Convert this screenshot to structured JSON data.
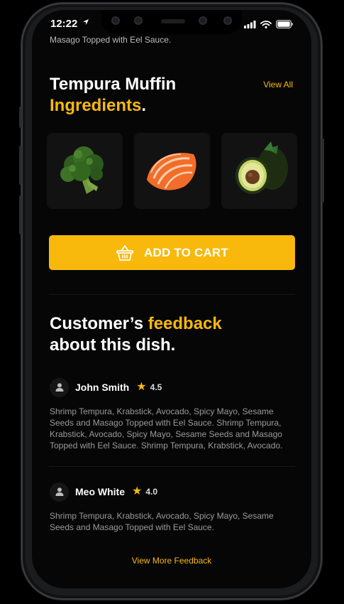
{
  "status_bar": {
    "time": "12:22",
    "location_icon": "location-arrow-icon",
    "icons": [
      "signal-icon",
      "wifi-icon",
      "battery-icon"
    ]
  },
  "dish": {
    "partial_description": "Masago Topped with Eel Sauce."
  },
  "ingredients_section": {
    "title_line1": "Tempura Muffin",
    "title_accent": "Ingredients",
    "title_end": ".",
    "view_all": "View All",
    "items": [
      {
        "name": "Broccoli",
        "icon": "broccoli-image"
      },
      {
        "name": "Salmon",
        "icon": "salmon-image"
      },
      {
        "name": "Avocado",
        "icon": "avocado-image"
      }
    ]
  },
  "cart": {
    "label": "ADD TO CART",
    "icon": "basket-icon"
  },
  "feedback": {
    "title_part1": "Customer’s ",
    "title_accent": "feedback",
    "title_line2": "about this dish.",
    "reviews": [
      {
        "name": "John Smith",
        "rating": "4.5",
        "text": "Shrimp Tempura, Krabstick, Avocado, Spicy Mayo, Sesame Seeds and Masago Topped with Eel Sauce. Shrimp Tempura, Krabstick, Avocado, Spicy Mayo, Sesame Seeds and Masago Topped with Eel Sauce. Shrimp Tempura, Krabstick, Avocado."
      },
      {
        "name": "Meo White",
        "rating": "4.0",
        "text": "Shrimp Tempura, Krabstick, Avocado, Spicy Mayo, Sesame Seeds and Masago Topped with Eel Sauce."
      }
    ],
    "view_more": "View More Feedback"
  },
  "colors": {
    "accent": "#f8b90c",
    "background": "#060606",
    "card": "#121212"
  }
}
